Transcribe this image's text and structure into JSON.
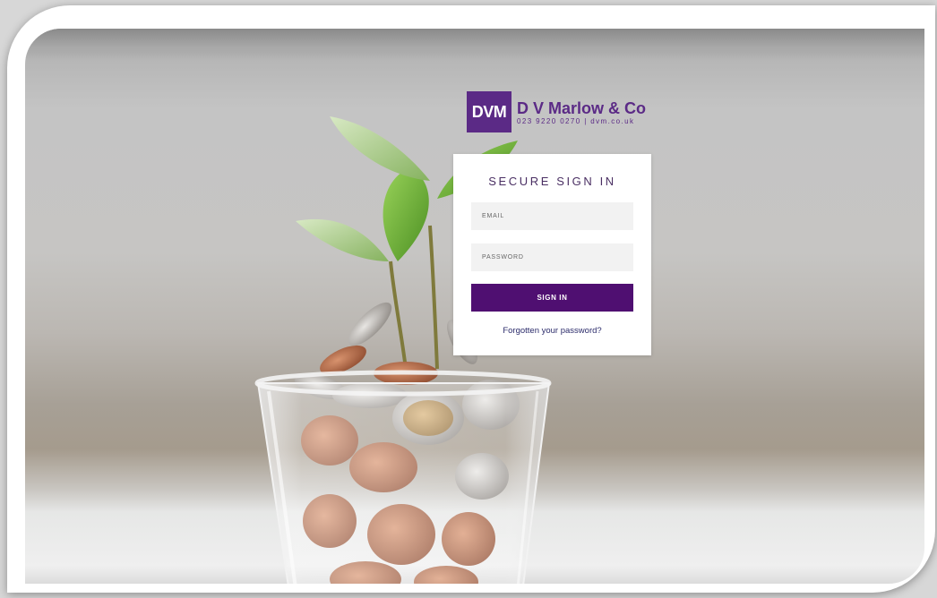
{
  "brand": {
    "logo_mark": "DVM",
    "name": "D V Marlow & Co",
    "contact": "023 9220 0270 | dvm.co.uk",
    "color": "#5b2a86"
  },
  "login": {
    "title": "SECURE SIGN IN",
    "email_placeholder": "EMAIL",
    "password_placeholder": "PASSWORD",
    "submit_label": "SIGN IN",
    "forgot_label": "Forgotten your password?",
    "button_color": "#4f0f71"
  }
}
